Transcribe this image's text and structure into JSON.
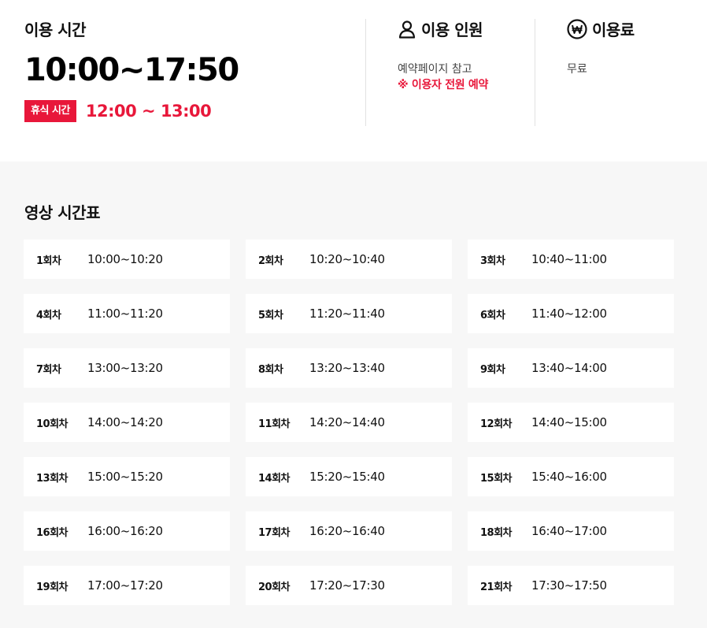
{
  "hours": {
    "title": "이용 시간",
    "time": "10:00~17:50",
    "rest_label": "휴식 시간",
    "rest_time": "12:00 ~ 13:00"
  },
  "people": {
    "icon": "person-icon",
    "title": "이용 인원",
    "desc": "예약페이지 참고",
    "notice": "※ 이용자 전원 예약"
  },
  "fee": {
    "icon": "won-icon",
    "title": "이용료",
    "desc": "무료"
  },
  "schedule": {
    "title": "영상 시간표",
    "items": [
      {
        "round": "1회차",
        "time": "10:00~10:20"
      },
      {
        "round": "2회차",
        "time": "10:20~10:40"
      },
      {
        "round": "3회차",
        "time": "10:40~11:00"
      },
      {
        "round": "4회차",
        "time": "11:00~11:20"
      },
      {
        "round": "5회차",
        "time": "11:20~11:40"
      },
      {
        "round": "6회차",
        "time": "11:40~12:00"
      },
      {
        "round": "7회차",
        "time": "13:00~13:20"
      },
      {
        "round": "8회차",
        "time": "13:20~13:40"
      },
      {
        "round": "9회차",
        "time": "13:40~14:00"
      },
      {
        "round": "10회차",
        "time": "14:00~14:20"
      },
      {
        "round": "11회차",
        "time": "14:20~14:40"
      },
      {
        "round": "12회차",
        "time": "14:40~15:00"
      },
      {
        "round": "13회차",
        "time": "15:00~15:20"
      },
      {
        "round": "14회차",
        "time": "15:20~15:40"
      },
      {
        "round": "15회차",
        "time": "15:40~16:00"
      },
      {
        "round": "16회차",
        "time": "16:00~16:20"
      },
      {
        "round": "17회차",
        "time": "16:20~16:40"
      },
      {
        "round": "18회차",
        "time": "16:40~17:00"
      },
      {
        "round": "19회차",
        "time": "17:00~17:20"
      },
      {
        "round": "20회차",
        "time": "17:20~17:30"
      },
      {
        "round": "21회차",
        "time": "17:30~17:50"
      }
    ]
  },
  "colors": {
    "accent": "#e8173a",
    "panel_bg": "#f7f7f7"
  }
}
